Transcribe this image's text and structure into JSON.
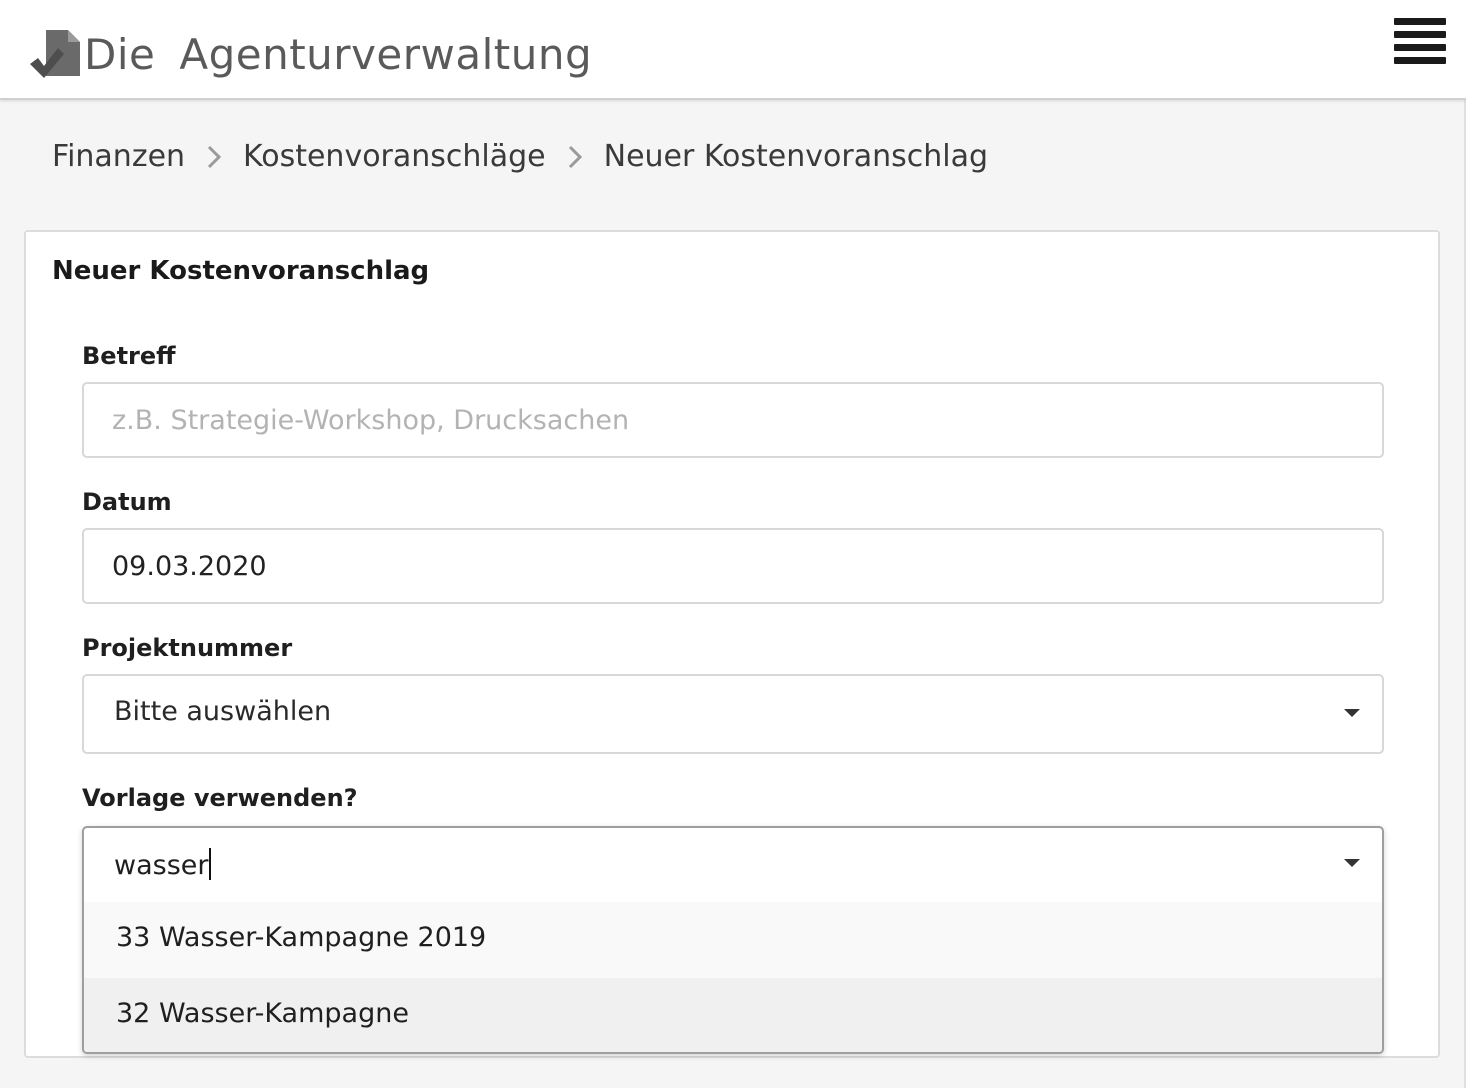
{
  "app": {
    "logo_text_1": "Die",
    "logo_text_2": "Agenturverwaltung"
  },
  "breadcrumb": [
    {
      "label": "Finanzen"
    },
    {
      "label": "Kostenvoranschläge"
    },
    {
      "label": "Neuer Kostenvoranschlag"
    }
  ],
  "form": {
    "title": "Neuer Kostenvoranschlag",
    "betreff": {
      "label": "Betreff",
      "value": "",
      "placeholder": "z.B. Strategie-Workshop, Drucksachen"
    },
    "datum": {
      "label": "Datum",
      "value": "09.03.2020"
    },
    "projektnummer": {
      "label": "Projektnummer",
      "selected": "Bitte auswählen"
    },
    "vorlage": {
      "label": "Vorlage verwenden?",
      "search_text": "wasser",
      "options": [
        {
          "label": "33 Wasser-Kampagne 2019"
        },
        {
          "label": "32 Wasser-Kampagne"
        }
      ]
    }
  },
  "icons": {
    "logo": "document-check-logo-icon",
    "menu": "hamburger-menu-icon",
    "breadcrumb_separator": "chevron-right-icon",
    "dropdown": "caret-down-icon"
  },
  "colors": {
    "background": "#f5f5f5",
    "panel": "#ffffff",
    "logo_text": "#5a5a5a",
    "placeholder": "#b3b3b3"
  }
}
